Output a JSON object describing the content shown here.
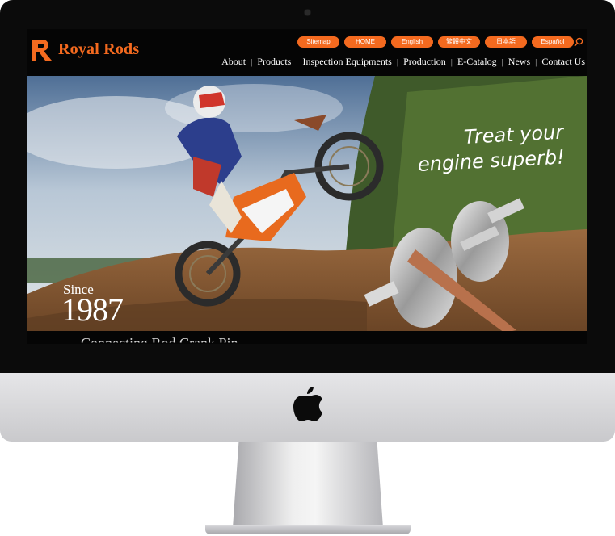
{
  "site": {
    "brand": "Royal Rods",
    "logo_letter": "R"
  },
  "top_links": [
    {
      "label": "Sitemap"
    },
    {
      "label": "HOME"
    },
    {
      "label": "English"
    },
    {
      "label": "繁體中文"
    },
    {
      "label": "日本語"
    },
    {
      "label": "Español"
    }
  ],
  "nav": [
    {
      "label": "About"
    },
    {
      "label": "Products"
    },
    {
      "label": "Inspection Equipments"
    },
    {
      "label": "Production"
    },
    {
      "label": "E-Catalog"
    },
    {
      "label": "News"
    },
    {
      "label": "Contact Us"
    }
  ],
  "hero": {
    "slogan_line1": "Treat your",
    "slogan_line2": "engine superb!",
    "since_label": "Since",
    "since_year": "1987",
    "partial_heading": "Connecting Rod Crank Pin"
  },
  "colors": {
    "accent": "#f46a1f",
    "screen_bg": "#050505",
    "bezel": "#0b0b0b"
  },
  "icons": {
    "search": "search-icon",
    "device_logo": "apple-logo-icon"
  }
}
